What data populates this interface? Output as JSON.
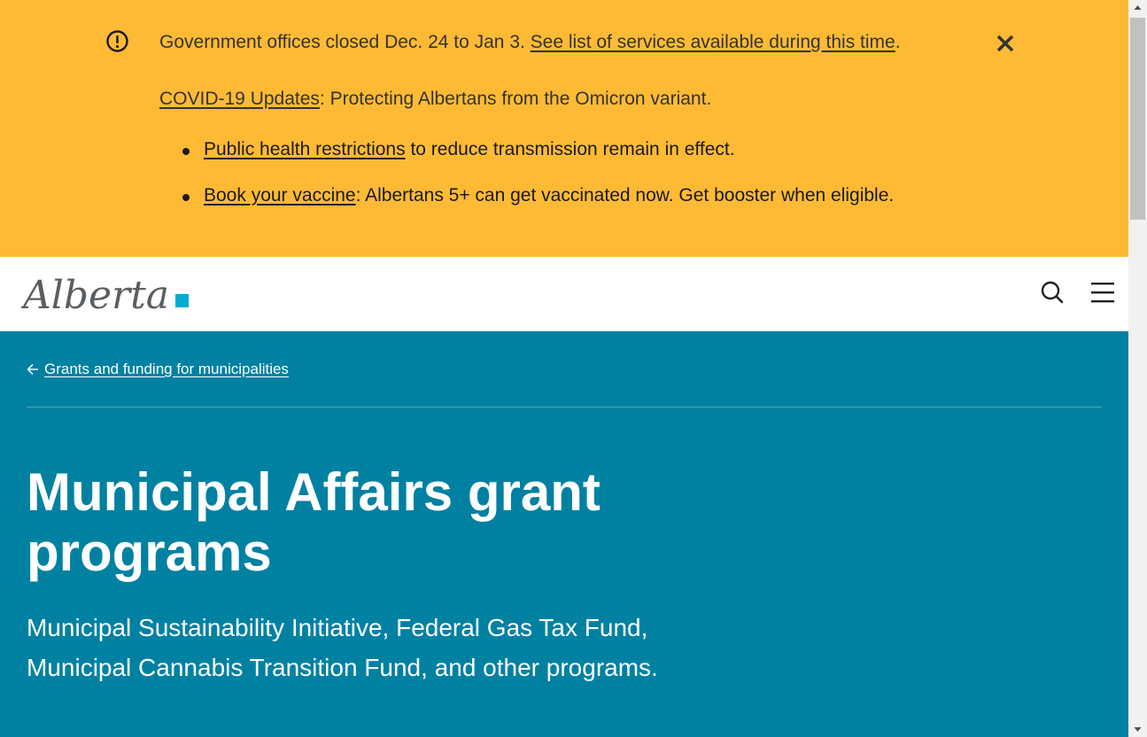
{
  "alert": {
    "line1_text": "Government offices closed Dec. 24 to Jan 3. ",
    "line1_link": "See list of services available during this time",
    "line1_end": ".",
    "line2_link": "COVID-19 Updates",
    "line2_text": ": Protecting Albertans from the Omicron variant.",
    "bullets": [
      {
        "link": "Public health restrictions",
        "text": " to reduce transmission remain in effect."
      },
      {
        "link": "Book your vaccine",
        "text": ": Albertans 5+ can get vaccinated now. Get booster when eligible."
      }
    ],
    "icon": "alert-circle-icon",
    "close_icon": "close-icon",
    "background_color": "#feba35"
  },
  "header": {
    "logo_text": "Alberta",
    "search_icon": "search-icon",
    "menu_icon": "hamburger-menu-icon"
  },
  "hero": {
    "breadcrumb": "Grants and funding for municipalities",
    "title": "Municipal Affairs grant programs",
    "subtitle": "Municipal Sustainability Initiative, Federal Gas Tax Fund, Municipal Cannabis Transition Fund, and other programs.",
    "background_color": "#0081a2"
  }
}
